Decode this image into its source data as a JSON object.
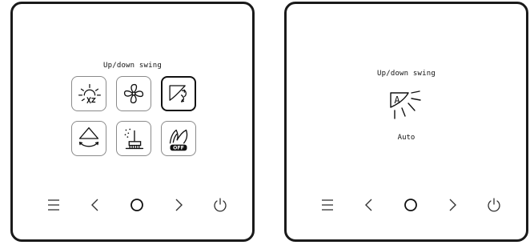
{
  "left_panel": {
    "title": "Up/down swing",
    "tiles": [
      {
        "icon": "sun-sleep-icon",
        "selected": false
      },
      {
        "icon": "fan-icon",
        "selected": false
      },
      {
        "icon": "up-down-swing-icon",
        "selected": true
      },
      {
        "icon": "left-right-swing-icon",
        "selected": false
      },
      {
        "icon": "clean-brush-icon",
        "selected": false
      },
      {
        "icon": "wind-off-icon",
        "selected": false,
        "badge": "OFF"
      }
    ]
  },
  "right_panel": {
    "title": "Up/down swing",
    "auto_icon_letter": "A",
    "mode_label": "Auto"
  },
  "nav": [
    {
      "icon": "menu-icon"
    },
    {
      "icon": "chevron-left-icon"
    },
    {
      "icon": "home-circle-icon"
    },
    {
      "icon": "chevron-right-icon"
    },
    {
      "icon": "power-icon"
    }
  ]
}
